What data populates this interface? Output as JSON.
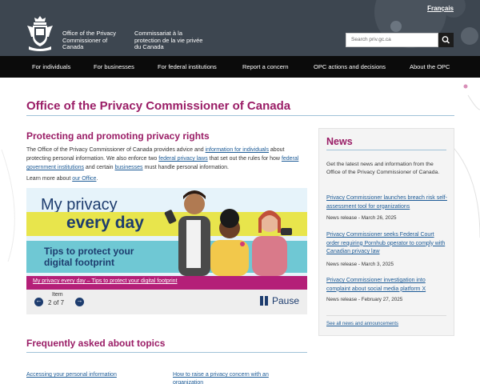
{
  "header": {
    "language_link": "Français",
    "brand_en": "Office of the Privacy Commissioner of Canada",
    "brand_fr": "Commissariat à la protection de la vie privée du Canada",
    "search_placeholder": "Search priv.gc.ca"
  },
  "nav": {
    "items": [
      {
        "label": "For individuals"
      },
      {
        "label": "For businesses"
      },
      {
        "label": "For federal institutions"
      },
      {
        "label": "Report a concern"
      },
      {
        "label": "OPC actions and decisions"
      },
      {
        "label": "About the OPC"
      }
    ]
  },
  "main": {
    "page_title": "Office of the Privacy Commissioner of Canada",
    "section_title": "Protecting and promoting privacy rights",
    "intro_1": "The Office of the Privacy Commissioner of Canada provides advice and ",
    "intro_link_1": "information for individuals",
    "intro_2": " about protecting personal information. We also enforce two ",
    "intro_link_2": "federal privacy laws",
    "intro_3": " that set out the rules for how ",
    "intro_link_3": "federal government institutions",
    "intro_4": " and certain ",
    "intro_link_4": "businesses",
    "intro_5": " must handle personal information.",
    "learn_prefix": "Learn more about ",
    "learn_link": "our Office",
    "learn_suffix": "."
  },
  "carousel": {
    "slide_title_1": "My privacy",
    "slide_title_2": "every day",
    "slide_subtitle": "Tips to protect your digital footprint",
    "caption": "My privacy every day – Tips to protect your digital footprint",
    "item_label": "Item",
    "item_count": "2 of 7",
    "pause_label": "Pause"
  },
  "news": {
    "title": "News",
    "description": "Get the latest news and information from the Office of the Privacy Commissioner of Canada.",
    "items": [
      {
        "title": "Privacy Commissioner launches breach risk self-assessment tool for organizations",
        "meta": "News release - March 26, 2025"
      },
      {
        "title": "Privacy Commissioner seeks Federal Court order requiring Pornhub operator to comply with Canadian privacy law",
        "meta": "News release - March 3, 2025"
      },
      {
        "title": "Privacy Commissioner investigation into complaint about social media platform X",
        "meta": "News release - February 27, 2025"
      }
    ],
    "see_all": "See all news and announcements"
  },
  "faq": {
    "title": "Frequently asked about topics",
    "links": [
      {
        "label": "Accessing your personal information"
      },
      {
        "label": "How to raise a privacy concern with an organization"
      }
    ]
  },
  "colors": {
    "header_bg": "#3d4650",
    "nav_bg": "#0b0b0b",
    "accent": "#9a1d66",
    "link": "#1b5a96",
    "caption_bar": "#b41f78"
  }
}
